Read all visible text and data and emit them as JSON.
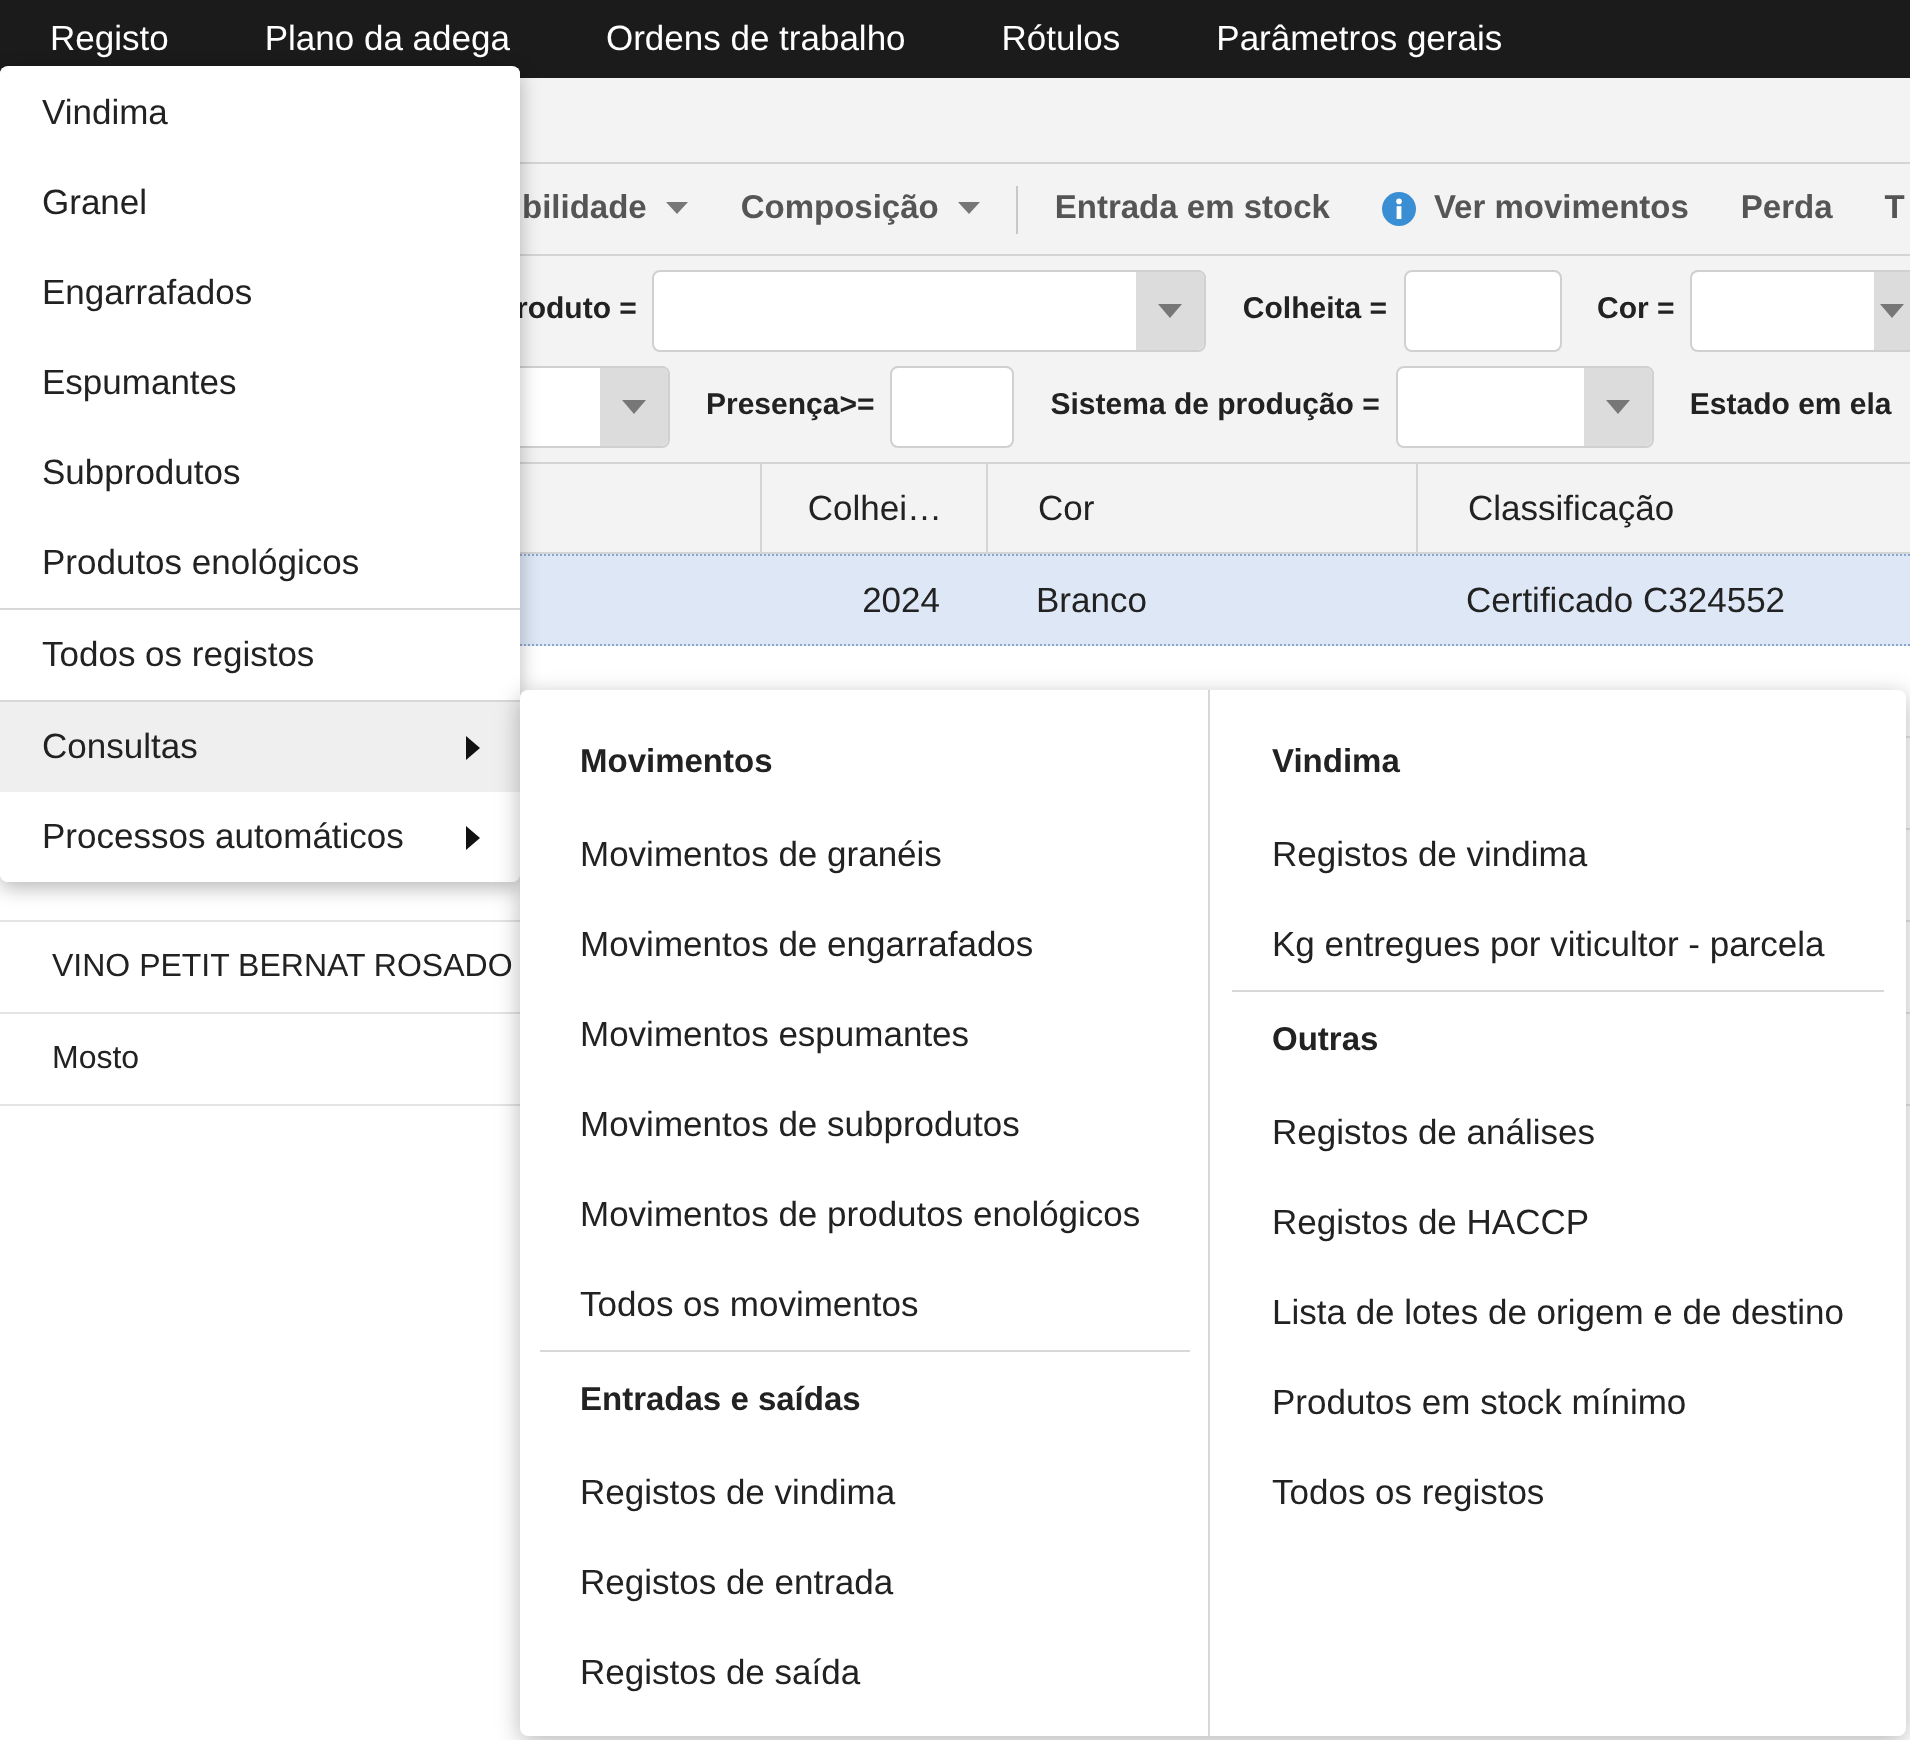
{
  "menu_bar": {
    "items": [
      {
        "label": "Registo"
      },
      {
        "label": "Plano da adega"
      },
      {
        "label": "Ordens de trabalho"
      },
      {
        "label": "Rótulos"
      },
      {
        "label": "Parâmetros gerais"
      }
    ]
  },
  "toolbar": {
    "groups": [
      {
        "items": [
          {
            "label": "bilidade",
            "kind": "dropdown"
          },
          {
            "label": "Composição",
            "kind": "dropdown"
          }
        ]
      },
      {
        "items": [
          {
            "label": "Entrada em stock",
            "kind": "action"
          },
          {
            "label": "Ver movimentos",
            "kind": "info"
          },
          {
            "label": "Perda",
            "kind": "action"
          },
          {
            "label": "T",
            "kind": "action"
          }
        ]
      }
    ]
  },
  "filter_bar": {
    "lines": [
      {
        "fields": [
          {
            "label": "roduto =",
            "kind": "select"
          },
          {
            "label": "Colheita =",
            "kind": "input"
          },
          {
            "label": "Cor =",
            "kind": "select"
          }
        ]
      },
      {
        "fields": [
          {
            "kind": "select"
          },
          {
            "label": "Presença>=",
            "kind": "input"
          },
          {
            "label": "Sistema de produção =",
            "kind": "select"
          },
          {
            "label": "Estado em ela",
            "kind": "label"
          }
        ]
      }
    ]
  },
  "table": {
    "columns": [
      {
        "label": "Colhei…"
      },
      {
        "label": "Cor"
      },
      {
        "label": "Classificação"
      }
    ],
    "rows": [
      {
        "selected": true,
        "colheita": "2024",
        "cor": "Branco",
        "classificacao": "Certificado C324552"
      },
      {
        "selected": false
      },
      {
        "selected": false
      },
      {
        "selected": false
      },
      {
        "selected": false,
        "column_1": "VINO PETIT BERNAT ROSADO"
      },
      {
        "selected": false,
        "column_1": "Mosto"
      }
    ]
  },
  "dropdown_menu": {
    "groups": [
      {
        "items": [
          {
            "label": "Vindima"
          },
          {
            "label": "Granel"
          },
          {
            "label": "Engarrafados"
          },
          {
            "label": "Espumantes"
          },
          {
            "label": "Subprodutos"
          },
          {
            "label": "Produtos enológicos"
          }
        ]
      },
      {
        "items": [
          {
            "label": "Todos os registos"
          }
        ]
      },
      {
        "items": [
          {
            "label": "Consultas",
            "submenu": true,
            "expanded": true
          },
          {
            "label": "Processos automáticos",
            "submenu": true,
            "expanded": false
          }
        ]
      }
    ]
  },
  "submenu": {
    "columns": [
      {
        "sections": [
          {
            "title": "Movimentos",
            "items": [
              "Movimentos de granéis",
              "Movimentos de engarrafados",
              "Movimentos espumantes",
              "Movimentos de subprodutos",
              "Movimentos de produtos enológicos",
              "Todos os movimentos"
            ]
          },
          {
            "title": "Entradas e saídas",
            "items": [
              "Registos de vindima",
              "Registos de entrada",
              "Registos de saída"
            ]
          }
        ]
      },
      {
        "sections": [
          {
            "title": "Vindima",
            "items": [
              "Registos de vindima",
              "Kg entregues por viticultor - parcela"
            ]
          },
          {
            "title": "Outras",
            "items": [
              "Registos de análises",
              "Registos de HACCP",
              "Lista de lotes de origem e de destino",
              "Produtos em stock mínimo",
              "Todos os registos"
            ]
          }
        ]
      }
    ]
  }
}
